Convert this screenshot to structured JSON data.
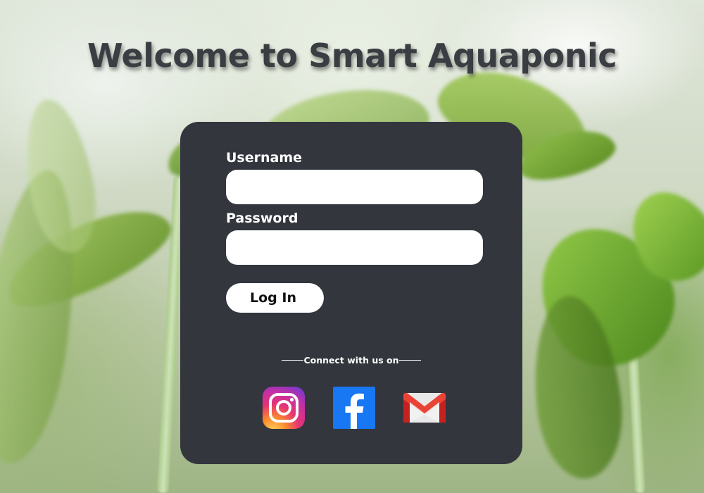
{
  "header": {
    "title": "Welcome to Smart Aquaponic"
  },
  "login_form": {
    "username_label": "Username",
    "username_value": "",
    "password_label": "Password",
    "password_value": "",
    "login_button_label": "Log In"
  },
  "social": {
    "heading": "Connect with us on",
    "links": [
      {
        "icon": "instagram-icon"
      },
      {
        "icon": "facebook-icon"
      },
      {
        "icon": "gmail-icon"
      }
    ]
  },
  "colors": {
    "card_background": "#34363e",
    "title_text": "#3a3d41",
    "facebook_blue": "#1877f2",
    "gmail_red": "#ea4335"
  }
}
